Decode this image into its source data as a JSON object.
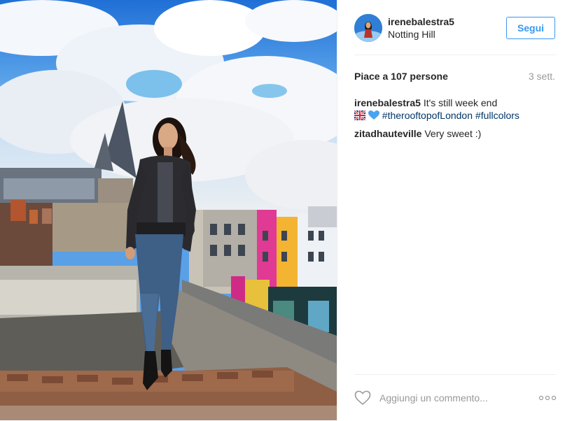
{
  "post": {
    "username": "irenebalestra5",
    "location": "Notting Hill",
    "follow_label": "Segui",
    "likes_label": "Piace a 107 persone",
    "time_ago": "3 sett."
  },
  "comments": [
    {
      "user": "irenebalestra5",
      "text": "It's still week end",
      "emojis": [
        "uk-flag-icon",
        "blue-heart-icon"
      ],
      "hashtags": [
        "#therooftopofLondon",
        "#fullcolors"
      ]
    },
    {
      "user": "zitadhauteville",
      "text": "Very sweet :)"
    }
  ],
  "footer": {
    "comment_placeholder": "Aggiungi un commento...",
    "like_icon": "heart-outline-icon",
    "more_icon": "more-options-icon"
  },
  "colors": {
    "accent": "#3897f0",
    "hashtag": "#003569",
    "muted": "#999999"
  }
}
